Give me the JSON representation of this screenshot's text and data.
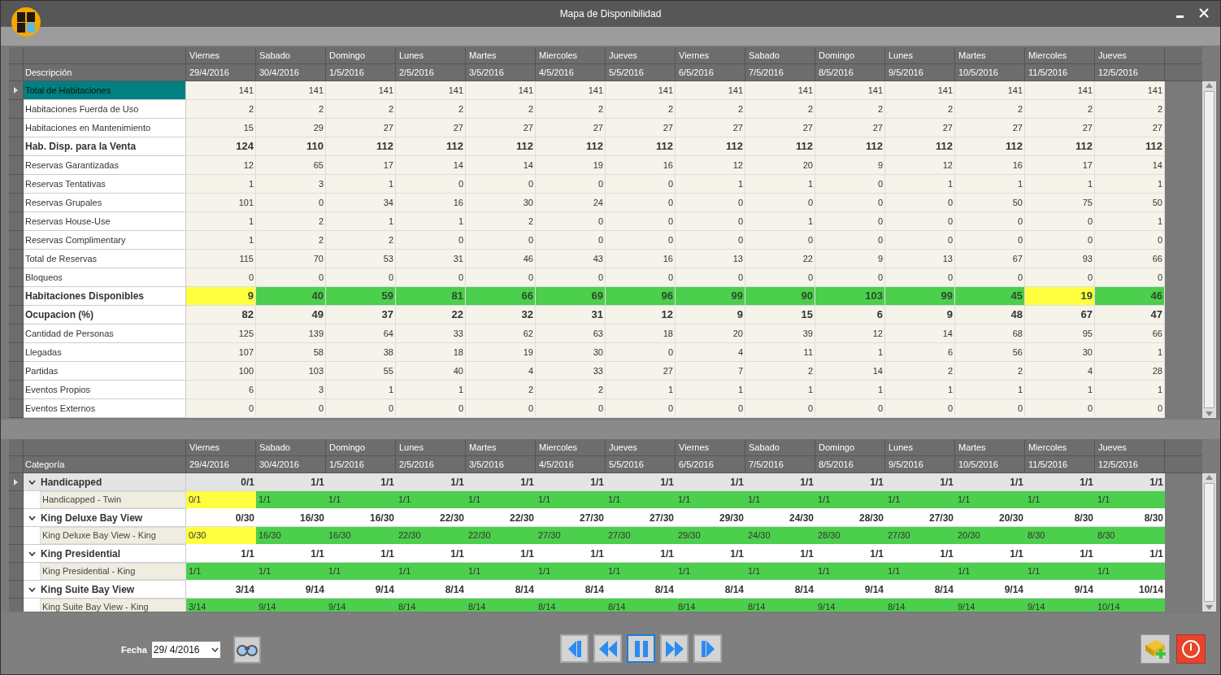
{
  "window": {
    "title": "Mapa de Disponibilidad"
  },
  "summary_grid": {
    "columns": [
      {
        "day": "Viernes",
        "date": "29/4/2016"
      },
      {
        "day": "Sabado",
        "date": "30/4/2016"
      },
      {
        "day": "Domingo",
        "date": "1/5/2016"
      },
      {
        "day": "Lunes",
        "date": "2/5/2016"
      },
      {
        "day": "Martes",
        "date": "3/5/2016"
      },
      {
        "day": "Miercoles",
        "date": "4/5/2016"
      },
      {
        "day": "Jueves",
        "date": "5/5/2016"
      },
      {
        "day": "Viernes",
        "date": "6/5/2016"
      },
      {
        "day": "Sabado",
        "date": "7/5/2016"
      },
      {
        "day": "Domingo",
        "date": "8/5/2016"
      },
      {
        "day": "Lunes",
        "date": "9/5/2016"
      },
      {
        "day": "Martes",
        "date": "10/5/2016"
      },
      {
        "day": "Miercoles",
        "date": "11/5/2016"
      },
      {
        "day": "Jueves",
        "date": "12/5/2016"
      }
    ],
    "label_header": "Descripción",
    "rows": [
      {
        "label": "Total de Habitaciones",
        "kind": "plain",
        "selected": true,
        "values": [
          "141",
          "141",
          "141",
          "141",
          "141",
          "141",
          "141",
          "141",
          "141",
          "141",
          "141",
          "141",
          "141",
          "141"
        ]
      },
      {
        "label": "Habitaciones Fuerda de Uso",
        "kind": "plain",
        "selected": false,
        "values": [
          "2",
          "2",
          "2",
          "2",
          "2",
          "2",
          "2",
          "2",
          "2",
          "2",
          "2",
          "2",
          "2",
          "2"
        ]
      },
      {
        "label": "Habitaciones en Mantenimiento",
        "kind": "plain",
        "selected": false,
        "values": [
          "15",
          "29",
          "27",
          "27",
          "27",
          "27",
          "27",
          "27",
          "27",
          "27",
          "27",
          "27",
          "27",
          "27"
        ]
      },
      {
        "label": "Hab. Disp. para la Venta",
        "kind": "bold",
        "selected": false,
        "values": [
          "124",
          "110",
          "112",
          "112",
          "112",
          "112",
          "112",
          "112",
          "112",
          "112",
          "112",
          "112",
          "112",
          "112"
        ]
      },
      {
        "label": "Reservas Garantizadas",
        "kind": "plain",
        "selected": false,
        "values": [
          "12",
          "65",
          "17",
          "14",
          "14",
          "19",
          "16",
          "12",
          "20",
          "9",
          "12",
          "16",
          "17",
          "14"
        ]
      },
      {
        "label": "Reservas Tentativas",
        "kind": "plain",
        "selected": false,
        "values": [
          "1",
          "3",
          "1",
          "0",
          "0",
          "0",
          "0",
          "1",
          "1",
          "0",
          "1",
          "1",
          "1",
          "1"
        ]
      },
      {
        "label": "Reservas Grupales",
        "kind": "plain",
        "selected": false,
        "values": [
          "101",
          "0",
          "34",
          "16",
          "30",
          "24",
          "0",
          "0",
          "0",
          "0",
          "0",
          "50",
          "75",
          "50"
        ]
      },
      {
        "label": "Reservas House-Use",
        "kind": "plain",
        "selected": false,
        "values": [
          "1",
          "2",
          "1",
          "1",
          "2",
          "0",
          "0",
          "0",
          "1",
          "0",
          "0",
          "0",
          "0",
          "1"
        ]
      },
      {
        "label": "Reservas Complimentary",
        "kind": "plain",
        "selected": false,
        "values": [
          "1",
          "2",
          "2",
          "0",
          "0",
          "0",
          "0",
          "0",
          "0",
          "0",
          "0",
          "0",
          "0",
          "0"
        ]
      },
      {
        "label": "Total de Reservas",
        "kind": "plain",
        "selected": false,
        "values": [
          "115",
          "70",
          "53",
          "31",
          "46",
          "43",
          "16",
          "13",
          "22",
          "9",
          "13",
          "67",
          "93",
          "66"
        ]
      },
      {
        "label": "Bloqueos",
        "kind": "plain",
        "selected": false,
        "values": [
          "0",
          "0",
          "0",
          "0",
          "0",
          "0",
          "0",
          "0",
          "0",
          "0",
          "0",
          "0",
          "0",
          "0"
        ]
      },
      {
        "label": "Habitaciones Disponibles",
        "kind": "colored",
        "selected": false,
        "cells": [
          {
            "text": "9",
            "color": "#ffff40"
          },
          {
            "text": "40",
            "color": "#4ccf4c"
          },
          {
            "text": "59",
            "color": "#4ccf4c"
          },
          {
            "text": "81",
            "color": "#4ccf4c"
          },
          {
            "text": "66",
            "color": "#4ccf4c"
          },
          {
            "text": "69",
            "color": "#4ccf4c"
          },
          {
            "text": "96",
            "color": "#4ccf4c"
          },
          {
            "text": "99",
            "color": "#4ccf4c"
          },
          {
            "text": "90",
            "color": "#4ccf4c"
          },
          {
            "text": "103",
            "color": "#4ccf4c"
          },
          {
            "text": "99",
            "color": "#4ccf4c"
          },
          {
            "text": "45",
            "color": "#4ccf4c"
          },
          {
            "text": "19",
            "color": "#ffff40"
          },
          {
            "text": "46",
            "color": "#4ccf4c"
          }
        ]
      },
      {
        "label": "Ocupacion (%)",
        "kind": "bold",
        "selected": false,
        "values": [
          "82",
          "49",
          "37",
          "22",
          "32",
          "31",
          "12",
          "9",
          "15",
          "6",
          "9",
          "48",
          "67",
          "47"
        ]
      },
      {
        "label": "Cantidad de Personas",
        "kind": "plain",
        "selected": false,
        "values": [
          "125",
          "139",
          "64",
          "33",
          "62",
          "63",
          "18",
          "20",
          "39",
          "12",
          "14",
          "68",
          "95",
          "66"
        ]
      },
      {
        "label": "Llegadas",
        "kind": "plain",
        "selected": false,
        "values": [
          "107",
          "58",
          "38",
          "18",
          "19",
          "30",
          "0",
          "4",
          "11",
          "1",
          "6",
          "56",
          "30",
          "1"
        ]
      },
      {
        "label": "Partidas",
        "kind": "plain",
        "selected": false,
        "values": [
          "100",
          "103",
          "55",
          "40",
          "4",
          "33",
          "27",
          "7",
          "2",
          "14",
          "2",
          "2",
          "4",
          "28"
        ]
      },
      {
        "label": "Eventos Propios",
        "kind": "plain",
        "selected": false,
        "values": [
          "6",
          "3",
          "1",
          "1",
          "2",
          "2",
          "1",
          "1",
          "1",
          "1",
          "1",
          "1",
          "1",
          "1"
        ]
      },
      {
        "label": "Eventos Externos",
        "kind": "plain",
        "selected": false,
        "values": [
          "0",
          "0",
          "0",
          "0",
          "0",
          "0",
          "0",
          "0",
          "0",
          "0",
          "0",
          "0",
          "0",
          "0"
        ]
      }
    ]
  },
  "category_grid": {
    "columns": [
      {
        "day": "Viernes",
        "date": "29/4/2016"
      },
      {
        "day": "Sabado",
        "date": "30/4/2016"
      },
      {
        "day": "Domingo",
        "date": "1/5/2016"
      },
      {
        "day": "Lunes",
        "date": "2/5/2016"
      },
      {
        "day": "Martes",
        "date": "3/5/2016"
      },
      {
        "day": "Miercoles",
        "date": "4/5/2016"
      },
      {
        "day": "Jueves",
        "date": "5/5/2016"
      },
      {
        "day": "Viernes",
        "date": "6/5/2016"
      },
      {
        "day": "Sabado",
        "date": "7/5/2016"
      },
      {
        "day": "Domingo",
        "date": "8/5/2016"
      },
      {
        "day": "Lunes",
        "date": "9/5/2016"
      },
      {
        "day": "Martes",
        "date": "10/5/2016"
      },
      {
        "day": "Miercoles",
        "date": "11/5/2016"
      },
      {
        "day": "Jueves",
        "date": "12/5/2016"
      }
    ],
    "label_header": "Categoría",
    "groups": [
      {
        "label": "Handicapped",
        "expanded": true,
        "selected": true,
        "values": [
          "0/1",
          "1/1",
          "1/1",
          "1/1",
          "1/1",
          "1/1",
          "1/1",
          "1/1",
          "1/1",
          "1/1",
          "1/1",
          "1/1",
          "1/1",
          "1/1"
        ],
        "children": [
          {
            "label": "Handicapped - Twin",
            "cells": [
              {
                "text": "0/1",
                "color": "#ffff40"
              },
              {
                "text": "1/1",
                "color": "#4ccf4c"
              },
              {
                "text": "1/1",
                "color": "#4ccf4c"
              },
              {
                "text": "1/1",
                "color": "#4ccf4c"
              },
              {
                "text": "1/1",
                "color": "#4ccf4c"
              },
              {
                "text": "1/1",
                "color": "#4ccf4c"
              },
              {
                "text": "1/1",
                "color": "#4ccf4c"
              },
              {
                "text": "1/1",
                "color": "#4ccf4c"
              },
              {
                "text": "1/1",
                "color": "#4ccf4c"
              },
              {
                "text": "1/1",
                "color": "#4ccf4c"
              },
              {
                "text": "1/1",
                "color": "#4ccf4c"
              },
              {
                "text": "1/1",
                "color": "#4ccf4c"
              },
              {
                "text": "1/1",
                "color": "#4ccf4c"
              },
              {
                "text": "1/1",
                "color": "#4ccf4c"
              }
            ]
          }
        ]
      },
      {
        "label": "King Deluxe Bay View",
        "expanded": true,
        "selected": false,
        "values": [
          "0/30",
          "16/30",
          "16/30",
          "22/30",
          "22/30",
          "27/30",
          "27/30",
          "29/30",
          "24/30",
          "28/30",
          "27/30",
          "20/30",
          "8/30",
          "8/30"
        ],
        "children": [
          {
            "label": "King Deluxe Bay View - King",
            "cells": [
              {
                "text": "0/30",
                "color": "#ffff40"
              },
              {
                "text": "16/30",
                "color": "#4ccf4c"
              },
              {
                "text": "16/30",
                "color": "#4ccf4c"
              },
              {
                "text": "22/30",
                "color": "#4ccf4c"
              },
              {
                "text": "22/30",
                "color": "#4ccf4c"
              },
              {
                "text": "27/30",
                "color": "#4ccf4c"
              },
              {
                "text": "27/30",
                "color": "#4ccf4c"
              },
              {
                "text": "29/30",
                "color": "#4ccf4c"
              },
              {
                "text": "24/30",
                "color": "#4ccf4c"
              },
              {
                "text": "28/30",
                "color": "#4ccf4c"
              },
              {
                "text": "27/30",
                "color": "#4ccf4c"
              },
              {
                "text": "20/30",
                "color": "#4ccf4c"
              },
              {
                "text": "8/30",
                "color": "#4ccf4c"
              },
              {
                "text": "8/30",
                "color": "#4ccf4c"
              }
            ]
          }
        ]
      },
      {
        "label": "King Presidential",
        "expanded": true,
        "selected": false,
        "values": [
          "1/1",
          "1/1",
          "1/1",
          "1/1",
          "1/1",
          "1/1",
          "1/1",
          "1/1",
          "1/1",
          "1/1",
          "1/1",
          "1/1",
          "1/1",
          "1/1"
        ],
        "children": [
          {
            "label": "King Presidential - King",
            "cells": [
              {
                "text": "1/1",
                "color": "#4ccf4c"
              },
              {
                "text": "1/1",
                "color": "#4ccf4c"
              },
              {
                "text": "1/1",
                "color": "#4ccf4c"
              },
              {
                "text": "1/1",
                "color": "#4ccf4c"
              },
              {
                "text": "1/1",
                "color": "#4ccf4c"
              },
              {
                "text": "1/1",
                "color": "#4ccf4c"
              },
              {
                "text": "1/1",
                "color": "#4ccf4c"
              },
              {
                "text": "1/1",
                "color": "#4ccf4c"
              },
              {
                "text": "1/1",
                "color": "#4ccf4c"
              },
              {
                "text": "1/1",
                "color": "#4ccf4c"
              },
              {
                "text": "1/1",
                "color": "#4ccf4c"
              },
              {
                "text": "1/1",
                "color": "#4ccf4c"
              },
              {
                "text": "1/1",
                "color": "#4ccf4c"
              },
              {
                "text": "1/1",
                "color": "#4ccf4c"
              }
            ]
          }
        ]
      },
      {
        "label": "King Suite Bay View",
        "expanded": true,
        "selected": false,
        "values": [
          "3/14",
          "9/14",
          "9/14",
          "8/14",
          "8/14",
          "8/14",
          "8/14",
          "8/14",
          "8/14",
          "9/14",
          "8/14",
          "9/14",
          "9/14",
          "10/14"
        ],
        "children": [
          {
            "label": "King Suite Bay View - King",
            "cells": [
              {
                "text": "3/14",
                "color": "#4ccf4c"
              },
              {
                "text": "9/14",
                "color": "#4ccf4c"
              },
              {
                "text": "9/14",
                "color": "#4ccf4c"
              },
              {
                "text": "8/14",
                "color": "#4ccf4c"
              },
              {
                "text": "8/14",
                "color": "#4ccf4c"
              },
              {
                "text": "8/14",
                "color": "#4ccf4c"
              },
              {
                "text": "8/14",
                "color": "#4ccf4c"
              },
              {
                "text": "8/14",
                "color": "#4ccf4c"
              },
              {
                "text": "8/14",
                "color": "#4ccf4c"
              },
              {
                "text": "9/14",
                "color": "#4ccf4c"
              },
              {
                "text": "8/14",
                "color": "#4ccf4c"
              },
              {
                "text": "9/14",
                "color": "#4ccf4c"
              },
              {
                "text": "9/14",
                "color": "#4ccf4c"
              },
              {
                "text": "10/14",
                "color": "#4ccf4c"
              }
            ]
          }
        ]
      }
    ]
  },
  "footer": {
    "date_label": "Fecha",
    "date_value": "29/ 4/2016",
    "nav_buttons": [
      {
        "kind": "first",
        "selected": false
      },
      {
        "kind": "rewind",
        "selected": false
      },
      {
        "kind": "pause",
        "selected": true
      },
      {
        "kind": "forward",
        "selected": false
      },
      {
        "kind": "last",
        "selected": false
      }
    ]
  }
}
